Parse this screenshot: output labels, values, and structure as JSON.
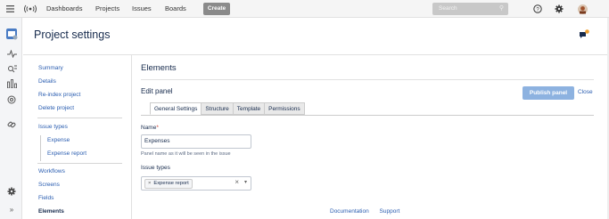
{
  "topbar": {
    "nav": [
      "Dashboards",
      "Projects",
      "Issues",
      "Boards"
    ],
    "create_label": "Create",
    "search_placeholder": "Search"
  },
  "header": {
    "title": "Project settings"
  },
  "sidebar": {
    "items": [
      {
        "label": "Summary"
      },
      {
        "label": "Details"
      },
      {
        "label": "Re-index project"
      },
      {
        "label": "Delete project"
      },
      {
        "label": "Issue types"
      },
      {
        "label": "Expense"
      },
      {
        "label": "Expense report"
      },
      {
        "label": "Workflows"
      },
      {
        "label": "Screens"
      },
      {
        "label": "Fields"
      },
      {
        "label": "Elements",
        "active": true
      }
    ]
  },
  "main": {
    "title": "Elements",
    "edit_panel_label": "Edit panel",
    "publish_label": "Publish panel",
    "close_label": "Close",
    "tabs": [
      {
        "label": "General Settings",
        "active": true
      },
      {
        "label": "Structure"
      },
      {
        "label": "Template"
      },
      {
        "label": "Permissions"
      }
    ],
    "name_label": "Name",
    "required_mark": "*",
    "name_value": "Expenses",
    "name_help": "Panel name as it will be seen in the issue",
    "issue_types_label": "Issue types",
    "issue_types_selected": [
      "Expense report"
    ],
    "chip_remove": "×",
    "clear_symbol": "×",
    "caret_symbol": "▾"
  },
  "footer": {
    "links": [
      "Documentation",
      "Support"
    ]
  },
  "colors": {
    "accent": "#2a5db0",
    "publish_button": "#8db2e0",
    "create_button": "#8a8a8a",
    "topbar": "#f5f5f5"
  }
}
